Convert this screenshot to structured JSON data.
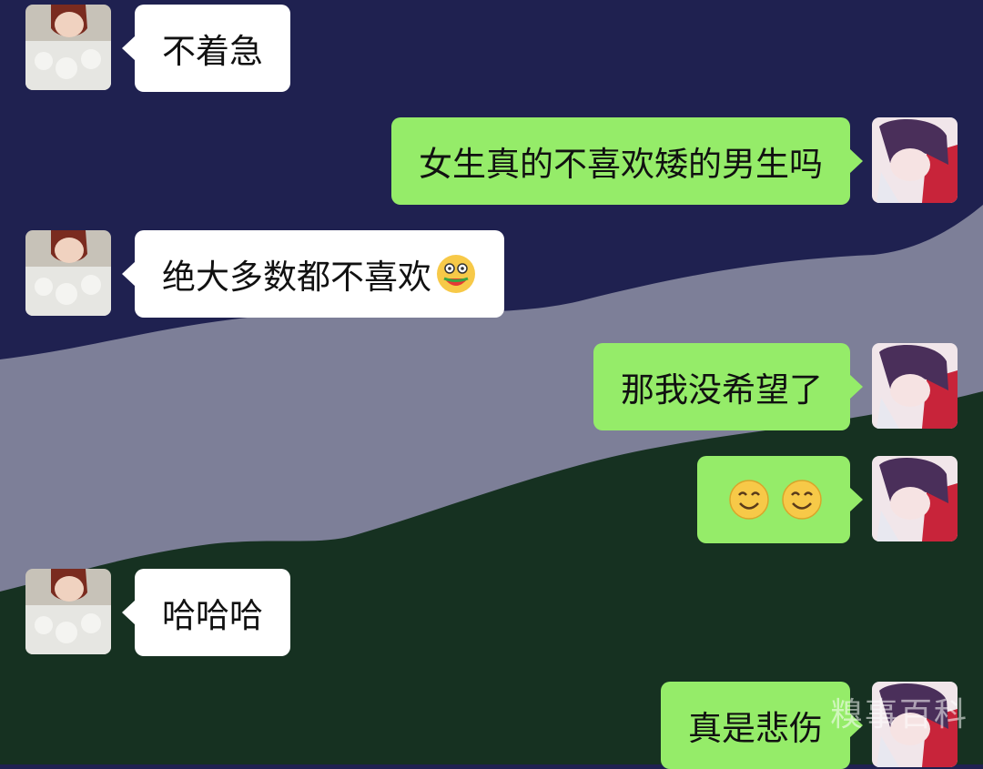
{
  "chat": {
    "messages": [
      {
        "side": "in",
        "text": "不着急"
      },
      {
        "side": "out",
        "text": "女生真的不喜欢矮的男生吗"
      },
      {
        "side": "in",
        "text": "绝大多数都不喜欢",
        "emoji": "watermelon-face-emoji"
      },
      {
        "side": "out",
        "text": "那我没希望了"
      },
      {
        "side": "out",
        "text": "",
        "emoji": "smile-emoji x2"
      },
      {
        "side": "in",
        "text": "哈哈哈"
      },
      {
        "side": "out",
        "text": "真是悲伤"
      }
    ]
  },
  "colors": {
    "sky": "#1f2150",
    "mountain": "#7d7f98",
    "hill": "#163121",
    "bubble_in": "#ffffff",
    "bubble_out": "#95ec69"
  },
  "watermark": "糗事百科"
}
